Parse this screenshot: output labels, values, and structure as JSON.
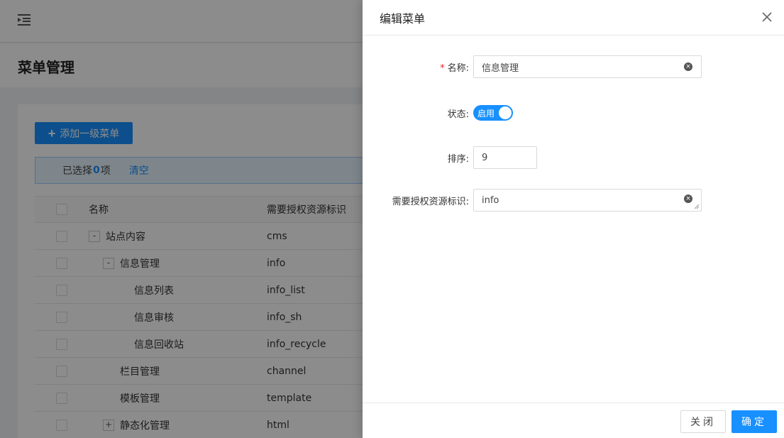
{
  "header": {
    "menu_icon": "indent-menu-icon"
  },
  "page": {
    "title": "菜单管理"
  },
  "toolbar": {
    "add_label": "添加一级菜单"
  },
  "selection": {
    "prefix": "已选择",
    "count": "0",
    "suffix": "项",
    "clear_label": "清空"
  },
  "table": {
    "columns": {
      "name": "名称",
      "resource": "需要授权资源标识"
    },
    "rows": [
      {
        "toggle": "-",
        "name": "站点内容",
        "resource": "cms"
      },
      {
        "toggle": "-",
        "name": "信息管理",
        "resource": "info"
      },
      {
        "toggle": "",
        "name": "信息列表",
        "resource": "info_list"
      },
      {
        "toggle": "",
        "name": "信息审核",
        "resource": "info_sh"
      },
      {
        "toggle": "",
        "name": "信息回收站",
        "resource": "info_recycle"
      },
      {
        "toggle": "",
        "name": "栏目管理",
        "resource": "channel"
      },
      {
        "toggle": "",
        "name": "模板管理",
        "resource": "template"
      },
      {
        "toggle": "+",
        "name": "静态化管理",
        "resource": "html"
      }
    ]
  },
  "drawer": {
    "title": "编辑菜单",
    "form": {
      "name_label": "名称:",
      "name_value": "信息管理",
      "status_label": "状态:",
      "status_value": "启用",
      "sort_label": "排序:",
      "sort_value": "9",
      "resource_label": "需要授权资源标识:",
      "resource_value": "info"
    },
    "close_label": "关闭",
    "ok_label": "确定"
  },
  "colors": {
    "primary": "#1890ff",
    "required": "#f5222d"
  }
}
